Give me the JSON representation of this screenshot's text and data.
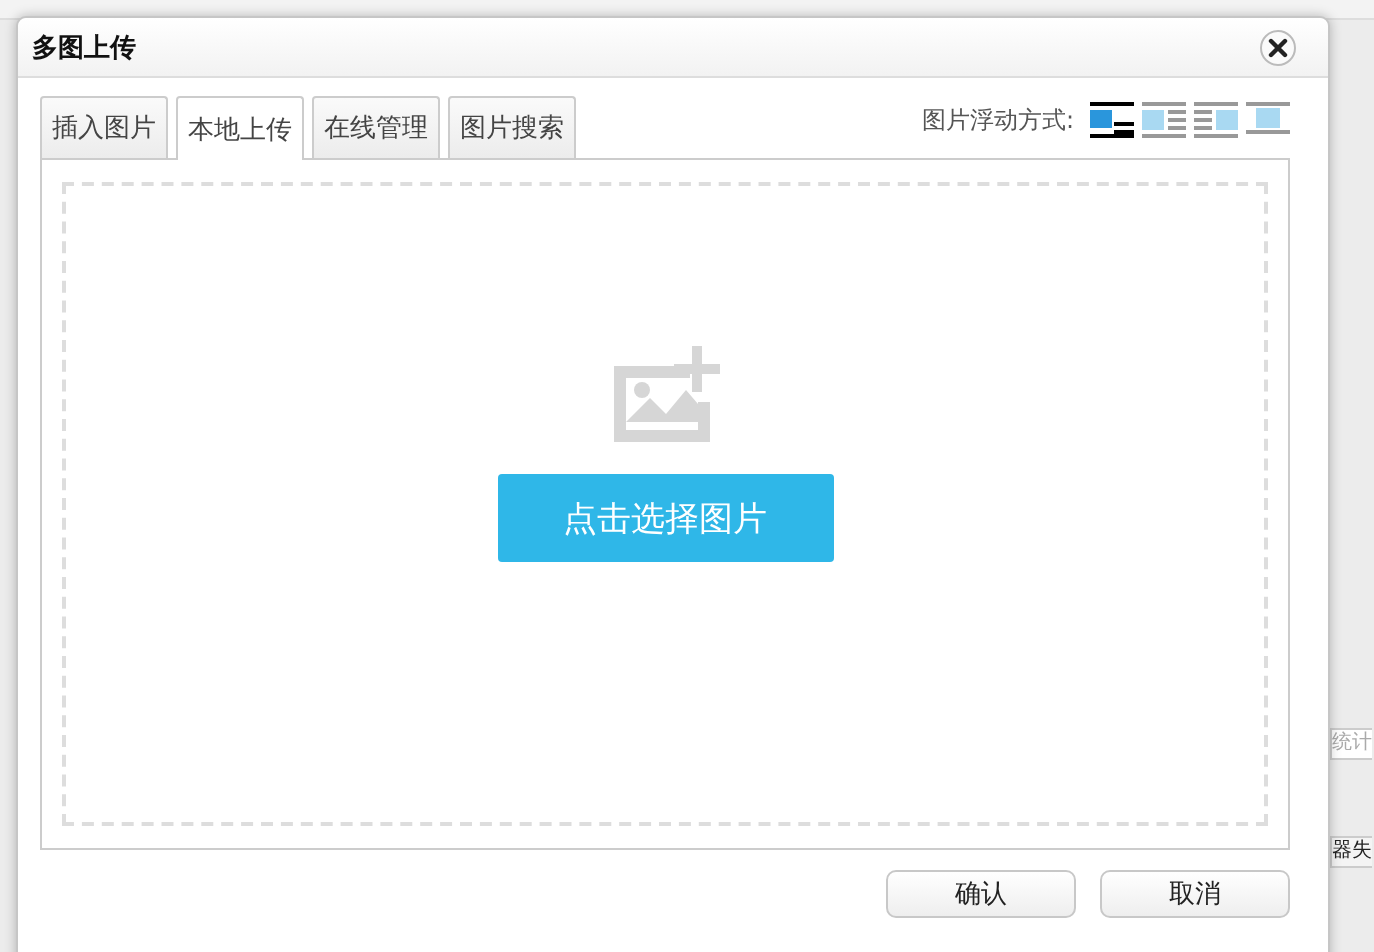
{
  "background": {
    "right_texts": [
      {
        "text": "统计",
        "disabled": true
      },
      {
        "text": "器失",
        "disabled": false
      }
    ]
  },
  "dialog": {
    "title": "多图上传",
    "tabs": [
      {
        "label": "插入图片",
        "selected": false
      },
      {
        "label": "本地上传",
        "selected": true
      },
      {
        "label": "在线管理",
        "selected": false
      },
      {
        "label": "图片搜索",
        "selected": false
      }
    ],
    "float_label": "图片浮动方式:",
    "float_options": [
      {
        "kind": "none",
        "selected": true
      },
      {
        "kind": "left",
        "selected": false
      },
      {
        "kind": "right",
        "selected": false
      },
      {
        "kind": "center",
        "selected": false
      }
    ],
    "upload_button": "点击选择图片",
    "buttons": [
      "确认",
      "取消"
    ]
  }
}
